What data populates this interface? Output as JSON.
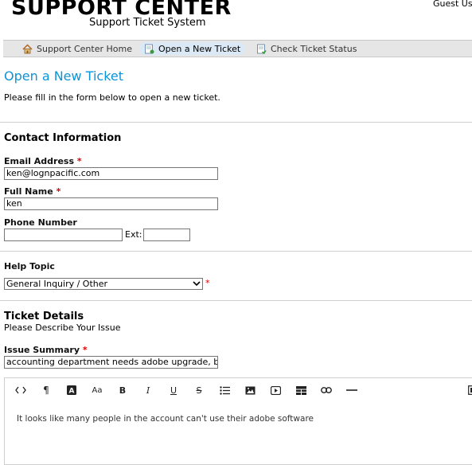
{
  "header": {
    "title": "SUPPORT CENTER",
    "subtitle": "Support Ticket System",
    "guest_label": "Guest Use"
  },
  "nav": {
    "items": [
      {
        "label": "Support Center Home",
        "icon": "home-icon"
      },
      {
        "label": "Open a New Ticket",
        "icon": "new-ticket-icon"
      },
      {
        "label": "Check Ticket Status",
        "icon": "ticket-status-icon"
      }
    ]
  },
  "page": {
    "title": "Open a New Ticket",
    "intro": "Please fill in the form below to open a new ticket."
  },
  "contact": {
    "heading": "Contact Information",
    "email_label": "Email Address",
    "email_value": "ken@lognpacific.com",
    "name_label": "Full Name",
    "name_value": "ken",
    "phone_label": "Phone Number",
    "phone_value": "",
    "ext_label": "Ext:",
    "ext_value": "",
    "required_mark": "*"
  },
  "help_topic": {
    "heading": "Help Topic",
    "selected": "General Inquiry / Other",
    "required_mark": "*"
  },
  "ticket": {
    "heading": "Ticket Details",
    "subheading": "Please Describe Your Issue",
    "summary_label": "Issue Summary",
    "summary_value": "accounting department needs adobe upgrade, broker",
    "required_mark": "*",
    "body_text": "It looks like many people in the account can't use their adobe software"
  },
  "toolbar": {
    "buttons": [
      {
        "icon": "code-view-icon",
        "glyph": "<>"
      },
      {
        "icon": "paragraph-icon",
        "glyph": "¶"
      },
      {
        "icon": "font-color-icon",
        "glyph": "A"
      },
      {
        "icon": "font-size-icon",
        "glyph": "Aa"
      },
      {
        "icon": "bold-icon",
        "glyph": "B"
      },
      {
        "icon": "italic-icon",
        "glyph": "I"
      },
      {
        "icon": "underline-icon",
        "glyph": "U"
      },
      {
        "icon": "strikethrough-icon",
        "glyph": "S"
      },
      {
        "icon": "bullet-list-icon",
        "glyph": "≡"
      },
      {
        "icon": "image-icon",
        "glyph": "▣"
      },
      {
        "icon": "video-icon",
        "glyph": "▶"
      },
      {
        "icon": "table-icon",
        "glyph": "▦"
      },
      {
        "icon": "link-icon",
        "glyph": "∞"
      },
      {
        "icon": "horizontal-rule-icon",
        "glyph": "—"
      }
    ]
  }
}
